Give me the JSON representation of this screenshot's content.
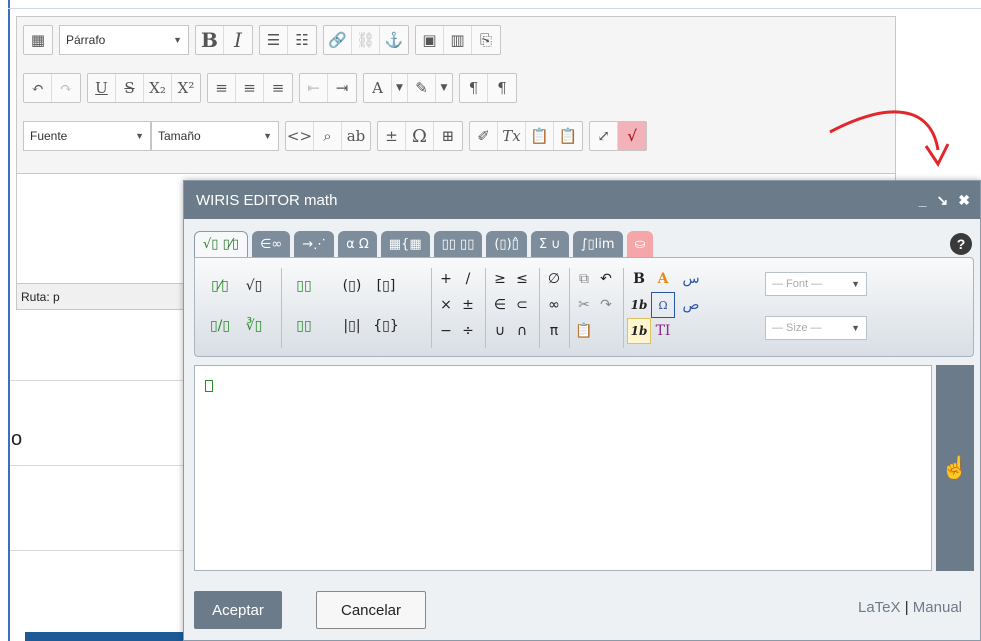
{
  "toolbar": {
    "format_select": "Párrafo",
    "font_select": "Fuente",
    "size_select": "Tamaño"
  },
  "editor": {
    "path_label": "Ruta: p"
  },
  "background": {
    "stray_text": "o"
  },
  "dialog": {
    "title": "WIRIS EDITOR math",
    "controls": [
      "_",
      "↘",
      "✖"
    ],
    "tabs": [
      "√▯ ▯⁄▯",
      "∈∞",
      "→⋰",
      "α Ω",
      "▦{▦",
      "▯▯ ▯▯",
      "(▯)▯̂",
      "Σ ∪",
      "∫▯lim",
      "⛀"
    ],
    "help": "?",
    "palette": {
      "fractions": [
        "▯⁄▯",
        "√▯",
        "▯/▯",
        "∛▯"
      ],
      "scripts": [
        "▯▯",
        "▯▯"
      ],
      "brackets": [
        "(▯)",
        "[▯]",
        "|▯|",
        "{▯}"
      ],
      "ops1": [
        "+",
        "/",
        "×",
        "±",
        "−",
        "÷"
      ],
      "ops2": [
        "≥",
        "≤",
        "∈",
        "⊂",
        "∪",
        "∩"
      ],
      "ops3": [
        "∅",
        "∞",
        "π"
      ],
      "edit": [
        "⧉",
        "↶",
        "✂",
        "↷",
        "📋"
      ],
      "style": [
        "B",
        "A",
        "1b",
        "Ω",
        "1b",
        "TI"
      ],
      "arabic": [
        "س",
        "ص"
      ],
      "font_select": "— Font —",
      "size_select": "— Size —"
    },
    "accept_label": "Aceptar",
    "cancel_label": "Cancelar",
    "latex_link": "LaTeX",
    "link_separator": "|",
    "manual_link": "Manual"
  },
  "colors": {
    "dialog_header": "#6b7b8a",
    "active_button": "#f3b2b9",
    "arrow": "#e3262a",
    "accent_green": "#2a8a2a"
  }
}
